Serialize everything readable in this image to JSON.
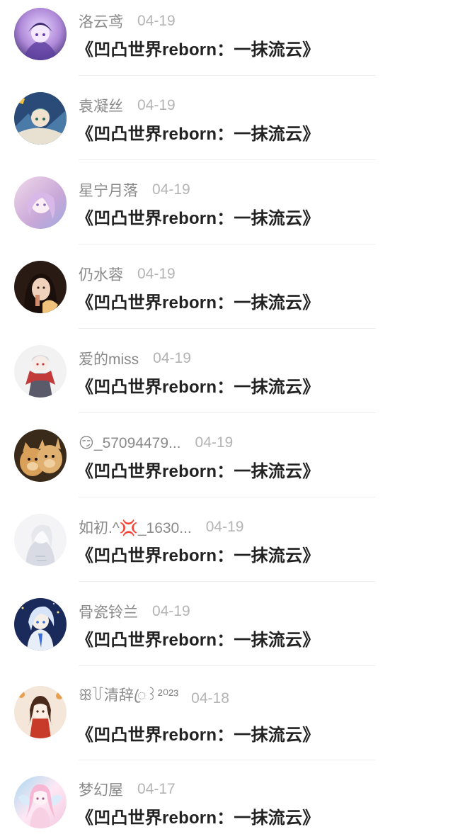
{
  "feed": {
    "items": [
      {
        "name": "洛云鸢",
        "time": "04-19",
        "title": "《凹凸世界reborn：一抹流云》",
        "avatar_icon": "anime-girl-purple-avatar",
        "colors": [
          "#3b2a6e",
          "#b08ad9",
          "#e8d7ff"
        ]
      },
      {
        "name": "袁凝丝",
        "time": "04-19",
        "title": "《凹凸世界reborn：一抹流云》",
        "avatar_icon": "anime-boy-green-avatar",
        "colors": [
          "#2a4a78",
          "#5fb0a0",
          "#e8e0d0"
        ]
      },
      {
        "name": "星宁月落",
        "time": "04-19",
        "title": "《凹凸世界reborn：一抹流云》",
        "avatar_icon": "anime-girl-pastel-avatar",
        "colors": [
          "#c9a8d8",
          "#f0d8ea",
          "#9fa8e0"
        ]
      },
      {
        "name": "仍水蓉",
        "time": "04-19",
        "title": "《凹凸世界reborn：一抹流云》",
        "avatar_icon": "photo-girl-avatar",
        "colors": [
          "#2a1a14",
          "#d08b6a",
          "#f1c27a"
        ]
      },
      {
        "name": "爱的miss",
        "time": "04-19",
        "title": "《凹凸世界reborn：一抹流云》",
        "avatar_icon": "anime-character-red-scarf-avatar",
        "colors": [
          "#f2f2f2",
          "#c23a3a",
          "#5a5a6a"
        ]
      },
      {
        "name": "😏_57094479...",
        "time": "04-19",
        "title": "《凹凸世界reborn：一抹流云》",
        "avatar_icon": "cats-photo-avatar",
        "colors": [
          "#3a2a1a",
          "#d9a05a",
          "#f0d0a0"
        ]
      },
      {
        "name": "如初.^💢_1630...",
        "time": "04-19",
        "title": "《凹凸世界reborn：一抹流云》",
        "avatar_icon": "white-sketch-girl-avatar",
        "colors": [
          "#f4f4f6",
          "#d8dbe3",
          "#b0b8c8"
        ]
      },
      {
        "name": "骨瓷铃兰",
        "time": "04-19",
        "title": "《凹凸世界reborn：一抹流云》",
        "avatar_icon": "anime-blue-hair-avatar",
        "colors": [
          "#1a2a5a",
          "#5a8ad8",
          "#e8eef8"
        ]
      },
      {
        "name": "ꕥ꒦清辞ꦿ꒱²⁰²³",
        "time": "04-18",
        "title": "《凹凸世界reborn：一抹流云》",
        "avatar_icon": "chibi-girl-red-dress-avatar",
        "colors": [
          "#f4e6d8",
          "#c83a2a",
          "#e8a050"
        ]
      },
      {
        "name": "梦幻屋",
        "time": "04-17",
        "title": "《凹凸世界reborn：一抹流云》",
        "avatar_icon": "fairy-girl-pink-avatar",
        "colors": [
          "#f2c8e0",
          "#a8d8f0",
          "#ffe8f4"
        ]
      }
    ]
  }
}
